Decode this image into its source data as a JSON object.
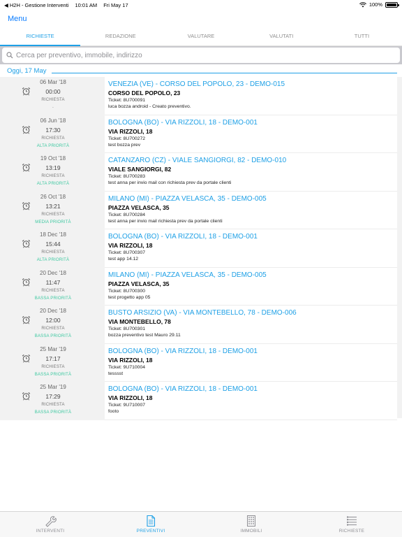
{
  "status_bar": {
    "carrier": "◀ H2H - Gestione Interventi",
    "time": "10:01 AM",
    "date": "Fri May 17",
    "battery": "100%",
    "battery_level": 1.0
  },
  "nav": {
    "menu_label": "Menu"
  },
  "tabs": [
    {
      "label": "RICHIESTE",
      "active": true
    },
    {
      "label": "REDAZIONE",
      "active": false
    },
    {
      "label": "VALUTARE",
      "active": false
    },
    {
      "label": "VALUTATI",
      "active": false
    },
    {
      "label": "TUTTI",
      "active": false
    }
  ],
  "search": {
    "placeholder": "Cerca per preventivo, immobile, indirizzo",
    "value": ""
  },
  "section": {
    "title": "Oggi, 17 May"
  },
  "colors": {
    "accent": "#1ea0e6",
    "priority_high": "#3cc8a0",
    "priority_medium": "#3cc8a0",
    "priority_low": "#3cc8a0"
  },
  "rows": [
    {
      "date": "06 Mar '18",
      "time": "00:00",
      "kind": "RICHIESTA",
      "priority": "-",
      "title": "VENEZIA (VE) - CORSO DEL POPOLO, 23 - DEMO-015",
      "address": "CORSO DEL POPOLO, 23",
      "ticket": "Ticket: 8U700091",
      "note": "luca bozza android - Creato preventivo."
    },
    {
      "date": "06 Jun '18",
      "time": "17:30",
      "kind": "RICHIESTA",
      "priority": "ALTA PRIORITÀ",
      "title": "BOLOGNA (BO) - VIA RIZZOLI, 18 - DEMO-001",
      "address": "VIA RIZZOLI, 18",
      "ticket": "Ticket: 8U700272",
      "note": "test bozza prev"
    },
    {
      "date": "19 Oct '18",
      "time": "13:19",
      "kind": "RICHIESTA",
      "priority": "ALTA PRIORITÀ",
      "title": "CATANZARO (CZ) - VIALE SANGIORGI, 82 - DEMO-010",
      "address": "VIALE SANGIORGI, 82",
      "ticket": "Ticket: 8U700283",
      "note": "test anna per invio mail con richiesta prev da portale clienti"
    },
    {
      "date": "26 Oct '18",
      "time": "13:21",
      "kind": "RICHIESTA",
      "priority": "MEDIA PRIORITÀ",
      "title": "MILANO (MI) - PIAZZA VELASCA, 35 - DEMO-005",
      "address": "PIAZZA VELASCA, 35",
      "ticket": "Ticket: 8U700284",
      "note": "test anna per invio mail richiesta prev da portale clienti"
    },
    {
      "date": "18 Dec '18",
      "time": "15:44",
      "kind": "RICHIESTA",
      "priority": "ALTA PRIORITÀ",
      "title": "BOLOGNA (BO) - VIA RIZZOLI, 18 - DEMO-001",
      "address": "VIA RIZZOLI, 18",
      "ticket": "Ticket: 8U700307",
      "note": "test app 14.12"
    },
    {
      "date": "20 Dec '18",
      "time": "11:47",
      "kind": "RICHIESTA",
      "priority": "BASSA PRIORITÀ",
      "title": "MILANO (MI) - PIAZZA VELASCA, 35 - DEMO-005",
      "address": "PIAZZA VELASCA, 35",
      "ticket": "Ticket: 8U700300",
      "note": "test progetto app 05"
    },
    {
      "date": "20 Dec '18",
      "time": "12:00",
      "kind": "RICHIESTA",
      "priority": "BASSA PRIORITÀ",
      "title": "BUSTO ARSIZIO (VA) - VIA MONTEBELLO, 78 - DEMO-006",
      "address": "VIA MONTEBELLO, 78",
      "ticket": "Ticket: 8U700301",
      "note": "bozza preventivo test Mauro 29.11"
    },
    {
      "date": "25 Mar '19",
      "time": "17:17",
      "kind": "RICHIESTA",
      "priority": "BASSA PRIORITÀ",
      "title": "BOLOGNA (BO) - VIA RIZZOLI, 18 - DEMO-001",
      "address": "VIA RIZZOLI, 18",
      "ticket": "Ticket: 9U710004",
      "note": "tesssst"
    },
    {
      "date": "25 Mar '19",
      "time": "17:29",
      "kind": "RICHIESTA",
      "priority": "BASSA PRIORITÀ",
      "title": "BOLOGNA (BO) - VIA RIZZOLI, 18 - DEMO-001",
      "address": "VIA RIZZOLI, 18",
      "ticket": "Ticket: 9U710007",
      "note": "footo"
    }
  ],
  "bottom_bar": [
    {
      "label": "INTERVENTI",
      "icon": "wrench-icon",
      "active": false
    },
    {
      "label": "PREVENTIVI",
      "icon": "document-icon",
      "active": true
    },
    {
      "label": "IMMOBILI",
      "icon": "building-icon",
      "active": false
    },
    {
      "label": "RICHIESTE",
      "icon": "list-icon",
      "active": false
    }
  ]
}
